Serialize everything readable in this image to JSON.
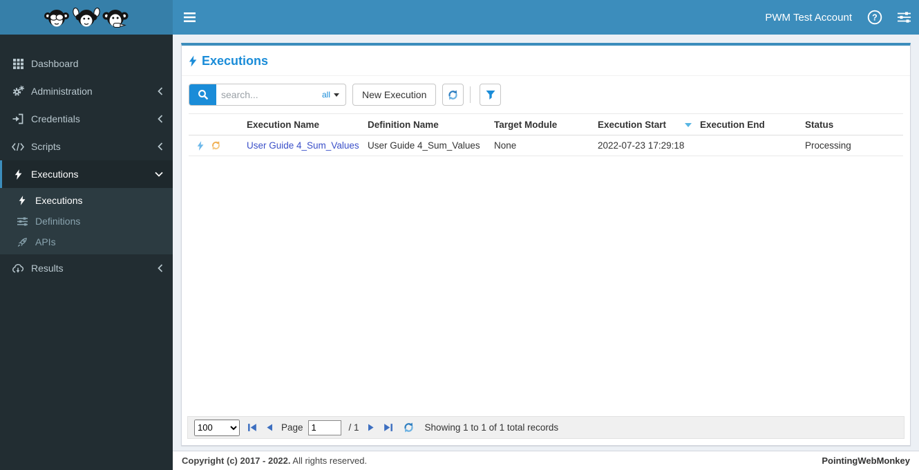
{
  "colors": {
    "header_blue": "#3c8dbc",
    "logo_bg": "#367fa9",
    "sidebar_bg": "#222d32",
    "sidebar_submenu_bg": "#2c3b41",
    "accent_blue": "#1a8cd8",
    "link_blue": "#3b50c9",
    "sort_indicator": "#57b5e3",
    "row_bolt": "#6db8ea",
    "row_refresh_orange": "#f0ad4e",
    "content_bg": "#ecf0f5"
  },
  "header": {
    "account_label": "PWM Test Account"
  },
  "sidebar": {
    "items": [
      {
        "label": "Dashboard",
        "icon": "grid-icon"
      },
      {
        "label": "Administration",
        "icon": "gears-icon"
      },
      {
        "label": "Credentials",
        "icon": "sign-in-icon"
      },
      {
        "label": "Scripts",
        "icon": "code-icon"
      },
      {
        "label": "Executions",
        "icon": "bolt-icon"
      },
      {
        "label": "Results",
        "icon": "cloud-download-icon"
      }
    ],
    "submenu": [
      {
        "label": "Executions",
        "icon": "bolt-icon"
      },
      {
        "label": "Definitions",
        "icon": "sliders-icon"
      },
      {
        "label": "APIs",
        "icon": "rocket-icon"
      }
    ]
  },
  "main": {
    "title": "Executions",
    "toolbar": {
      "search_placeholder": "search...",
      "search_scope": "all",
      "new_execution_label": "New Execution"
    },
    "table": {
      "columns": [
        "Execution Name",
        "Definition Name",
        "Target Module",
        "Execution Start",
        "Execution End",
        "Status"
      ],
      "sorted_column": "Execution Start",
      "rows": [
        {
          "execution_name": "User Guide 4_Sum_Values",
          "definition_name": "User Guide 4_Sum_Values",
          "target_module": "None",
          "execution_start": "2022-07-23 17:29:18",
          "execution_end": "",
          "status": "Processing"
        }
      ]
    },
    "pager": {
      "page_size": "100",
      "page_label": "Page",
      "page_value": "1",
      "page_total": "/ 1",
      "summary": "Showing 1 to 1 of 1 total records"
    }
  },
  "footer": {
    "copyright_strong": "Copyright (c) 2017 - 2022.",
    "copyright_text": "All rights reserved.",
    "brand": "PointingWebMonkey"
  }
}
